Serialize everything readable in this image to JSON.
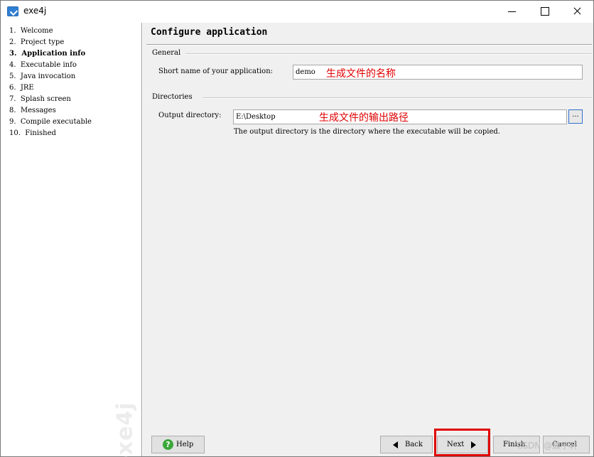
{
  "window": {
    "title": "exe4j"
  },
  "steps": [
    {
      "label": "1.  Welcome",
      "active": false
    },
    {
      "label": "2.  Project type",
      "active": false
    },
    {
      "label": "3.  Application info",
      "active": true
    },
    {
      "label": "4.  Executable info",
      "active": false
    },
    {
      "label": "5.  Java invocation",
      "active": false
    },
    {
      "label": "6.  JRE",
      "active": false
    },
    {
      "label": "7.  Splash screen",
      "active": false
    },
    {
      "label": "8.  Messages",
      "active": false
    },
    {
      "label": "9.  Compile executable",
      "active": false
    },
    {
      "label": "10.  Finished",
      "active": false
    }
  ],
  "watermark": "exe4j",
  "page": {
    "title": "Configure application",
    "general": {
      "group_label": "General",
      "short_name_label": "Short name of your application:",
      "short_name_value": "demo",
      "annotation": "生成文件的名称"
    },
    "directories": {
      "group_label": "Directories",
      "output_label": "Output directory:",
      "output_value": "E:\\Desktop",
      "browse_label": "...",
      "annotation": "生成文件的输出路径",
      "hint": "The output directory is the directory where the executable will be copied."
    }
  },
  "buttons": {
    "help": "Help",
    "back": "Back",
    "next": "Next",
    "finish": "Finish",
    "cancel": "Cancel"
  },
  "overlay": {
    "csdn": "CSDN @魏宇轩"
  },
  "colors": {
    "highlight": "#e00000",
    "annotation": "#e00000"
  },
  "icons": [
    "exe4j-app-icon",
    "minimize-icon",
    "maximize-icon",
    "close-icon",
    "help-icon",
    "arrow-left-icon",
    "arrow-right-icon"
  ]
}
